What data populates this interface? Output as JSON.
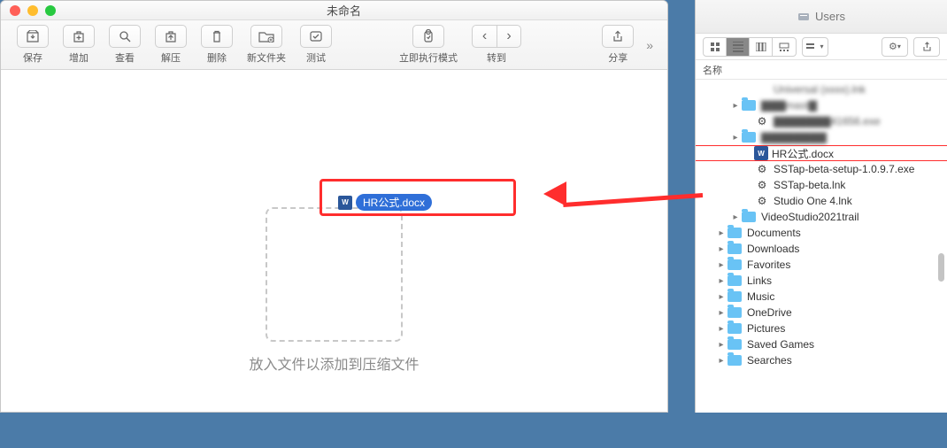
{
  "left": {
    "title": "未命名",
    "toolbar": {
      "save": "保存",
      "add": "增加",
      "view": "查看",
      "extract": "解压",
      "delete": "删除",
      "newFolder": "新文件夹",
      "test": "测试",
      "runMode": "立即执行模式",
      "goto": "转到",
      "share": "分享"
    },
    "draggedFile": "HR公式.docx",
    "dropHint": "放入文件以添加到压缩文件"
  },
  "right": {
    "title": "Users",
    "columnHeader": "名称",
    "rows": [
      {
        "indent": 3,
        "expand": false,
        "icon": "blur",
        "label": "Universal (xxxx).lnk",
        "blur": true
      },
      {
        "indent": 2,
        "expand": true,
        "icon": "folder",
        "label": "▇▇▇mast▇",
        "blur": true
      },
      {
        "indent": 3,
        "expand": false,
        "icon": "gear",
        "label": "▇▇▇▇▇▇▇41656.exe",
        "blur": true
      },
      {
        "indent": 2,
        "expand": true,
        "icon": "folder",
        "label": "▇▇▇▇▇▇▇▇",
        "blur": true
      },
      {
        "indent": 3,
        "expand": false,
        "icon": "word",
        "label": "HR公式.docx",
        "selected": true
      },
      {
        "indent": 3,
        "expand": false,
        "icon": "gear",
        "label": "SSTap-beta-setup-1.0.9.7.exe"
      },
      {
        "indent": 3,
        "expand": false,
        "icon": "gear",
        "label": "SSTap-beta.lnk"
      },
      {
        "indent": 3,
        "expand": false,
        "icon": "gear",
        "label": "Studio One 4.lnk"
      },
      {
        "indent": 2,
        "expand": true,
        "icon": "folder",
        "label": "VideoStudio2021trail"
      },
      {
        "indent": 1,
        "expand": true,
        "icon": "folder",
        "label": "Documents"
      },
      {
        "indent": 1,
        "expand": true,
        "icon": "folder",
        "label": "Downloads"
      },
      {
        "indent": 1,
        "expand": true,
        "icon": "folder",
        "label": "Favorites"
      },
      {
        "indent": 1,
        "expand": true,
        "icon": "folder",
        "label": "Links"
      },
      {
        "indent": 1,
        "expand": true,
        "icon": "folder",
        "label": "Music"
      },
      {
        "indent": 1,
        "expand": true,
        "icon": "folder",
        "label": "OneDrive"
      },
      {
        "indent": 1,
        "expand": true,
        "icon": "folder",
        "label": "Pictures"
      },
      {
        "indent": 1,
        "expand": true,
        "icon": "folder",
        "label": "Saved Games"
      },
      {
        "indent": 1,
        "expand": true,
        "icon": "folder",
        "label": "Searches"
      }
    ]
  }
}
